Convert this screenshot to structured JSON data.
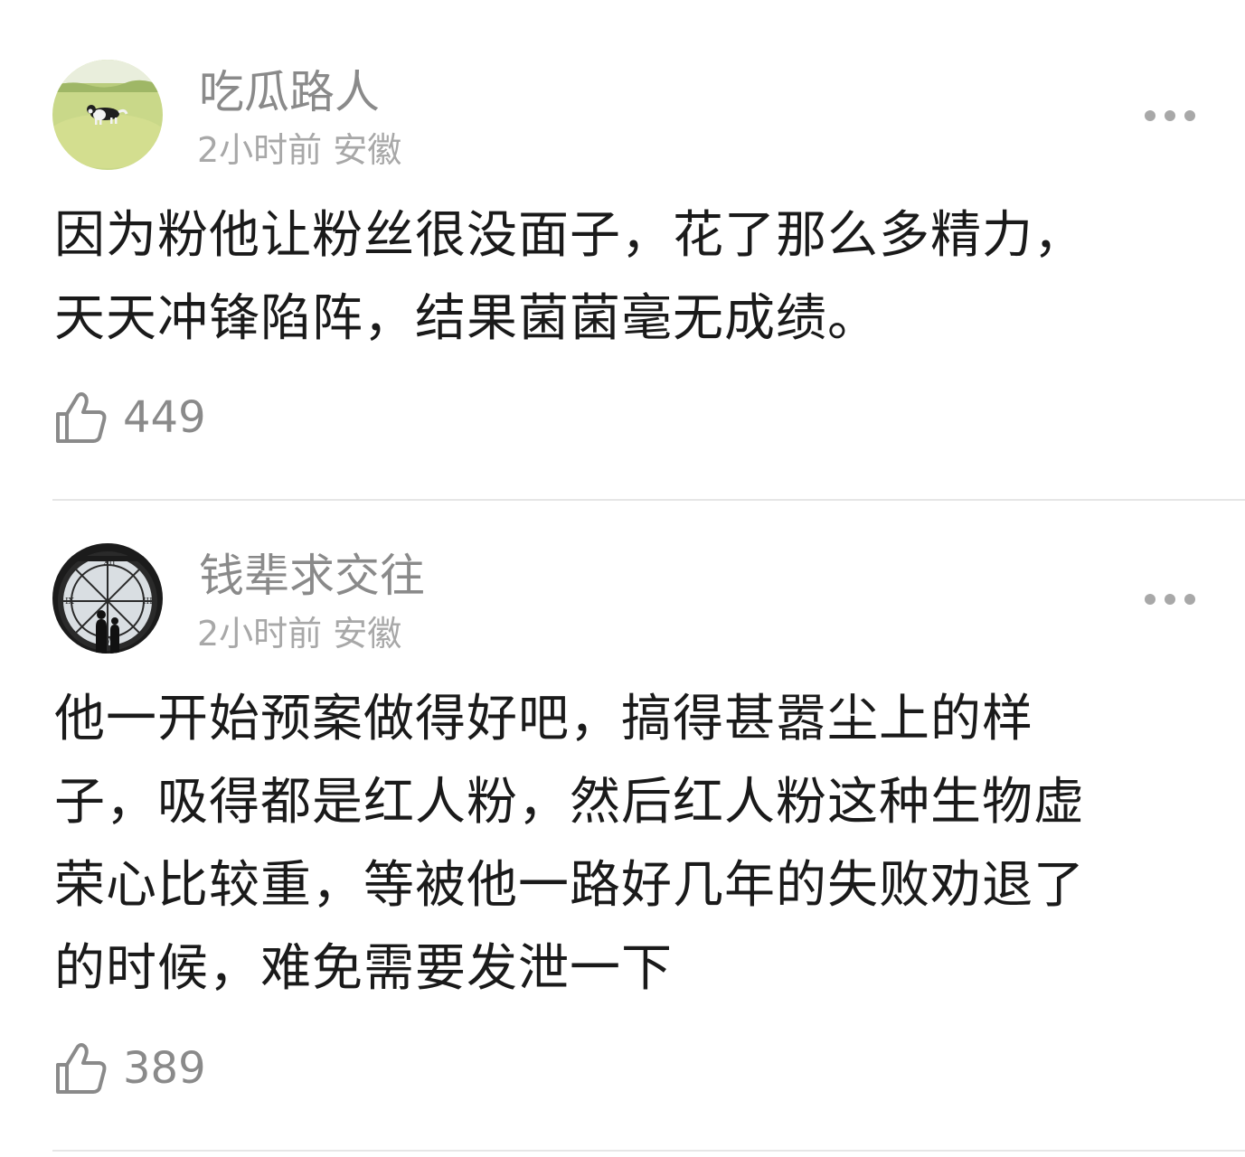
{
  "comments": [
    {
      "username": "吃瓜路人",
      "time": "2小时前",
      "location": "安徽",
      "text_lines": [
        "因为粉他让粉丝很没面子，花了那么多精力，",
        "天天冲锋陷阵，结果菌菌毫无成绩。"
      ],
      "likes": "449",
      "avatar_icon": "dog-on-grass-avatar",
      "more_icon": "more-dots-icon",
      "like_icon": "thumbs-up-icon"
    },
    {
      "username": "钱辈求交往",
      "time": "2小时前",
      "location": "安徽",
      "text_lines": [
        "他一开始预案做得好吧，搞得甚嚣尘上的样",
        "子，吸得都是红人粉，然后红人粉这种生物虚",
        "荣心比较重，等被他一路好几年的失败劝退了",
        "的时候，难免需要发泄一下"
      ],
      "likes": "389",
      "avatar_icon": "clock-window-avatar",
      "more_icon": "more-dots-icon",
      "like_icon": "thumbs-up-icon"
    }
  ],
  "colors": {
    "name_gray": "#8a8a8a",
    "meta_gray": "#a8a8a8",
    "text_dark": "#1a1a1a",
    "divider": "#e6e6e6"
  }
}
